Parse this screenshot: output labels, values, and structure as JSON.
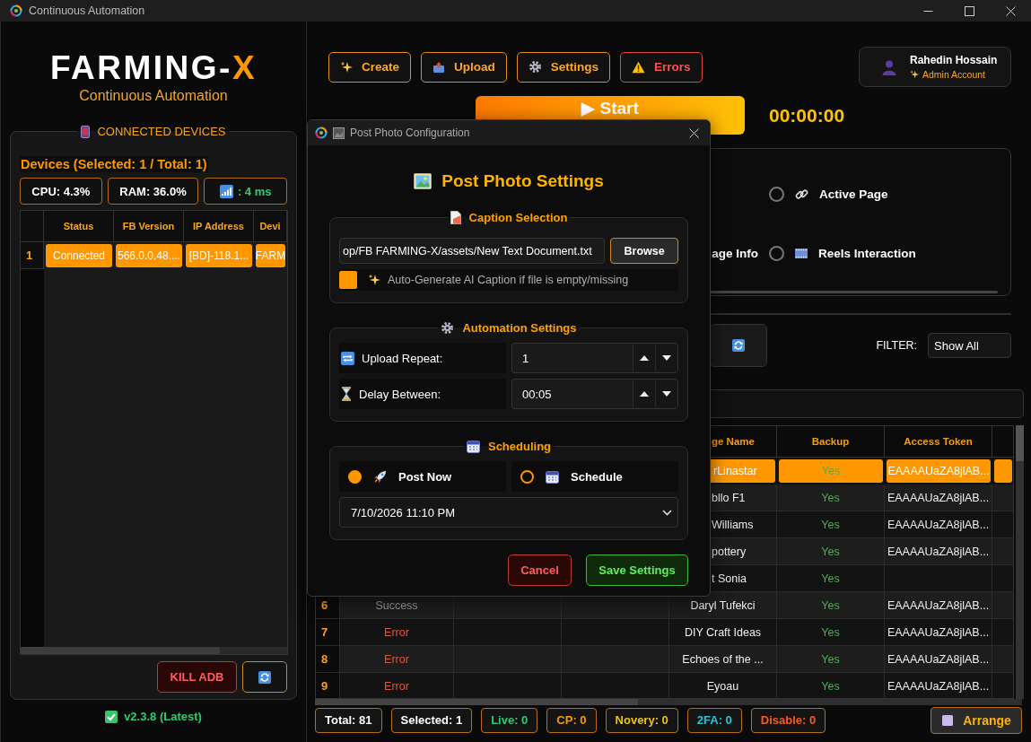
{
  "window": {
    "title": "Continuous Automation"
  },
  "sidebar": {
    "logo": {
      "text": "FARMING-",
      "accent": "X"
    },
    "subtitle": "Continuous Automation",
    "devices": {
      "title": "CONNECTED DEVICES",
      "summary": "Devices (Selected: 1 / Total: 1)",
      "stats": [
        {
          "kind": "cpu",
          "text": "CPU: 4.3%"
        },
        {
          "kind": "ram",
          "text": "RAM: 36.0%"
        },
        {
          "kind": "ping",
          "text": ": 4 ms"
        }
      ],
      "columns": [
        "Status",
        "FB Version",
        "IP Address",
        "Devi"
      ],
      "rows": [
        {
          "index": "1",
          "selected": true,
          "cells": [
            "Connected",
            "566.0.0.48....",
            "[BD]-118.1...",
            "FARM"
          ]
        }
      ],
      "buttons": [
        {
          "kind": "danger",
          "label": "KILL ADB"
        },
        {
          "kind": "refresh"
        }
      ]
    },
    "version": "v2.3.8 (Latest)"
  },
  "toolbar": [
    {
      "kind": "create",
      "label": "Create"
    },
    {
      "kind": "upload",
      "label": "Upload"
    },
    {
      "kind": "settings",
      "label": "Settings"
    },
    {
      "kind": "errors",
      "label": "Errors"
    }
  ],
  "user": {
    "name": "Rahedin Hossain",
    "role": "Admin Account"
  },
  "start": {
    "label": "▶ Start",
    "timer": "00:00:00"
  },
  "options": {
    "fragment": "age Info",
    "items": [
      {
        "kind": "link",
        "label": "Active Page",
        "selected": false
      },
      {
        "kind": "film",
        "label": "Reels Interaction",
        "selected": false
      }
    ]
  },
  "filter": {
    "label": "FILTER:",
    "value": "Show All"
  },
  "table": {
    "columns": {
      "page_name": "ge Name",
      "backup": "Backup",
      "access_token": "Access Token"
    },
    "rows": [
      {
        "selected": true,
        "page_name": "rLinastar",
        "backup": "Yes",
        "access_token": "EAAAAUaZA8jlAB..."
      },
      {
        "selected": false,
        "page_name": "bllo F1",
        "backup": "Yes",
        "access_token": "EAAAAUaZA8jlAB..."
      },
      {
        "selected": false,
        "page_name": "Williams",
        "backup": "Yes",
        "access_token": "EAAAAUaZA8jlAB..."
      },
      {
        "selected": false,
        "page_name": "pottery",
        "backup": "Yes",
        "access_token": "EAAAAUaZA8jlAB..."
      },
      {
        "selected": false,
        "page_name": "t Sonia",
        "backup": "Yes"
      },
      {
        "selected": false,
        "index": "6",
        "status": "Success",
        "kind": "success",
        "page_name": "Daryl Tufekci",
        "backup": "Yes",
        "access_token": "EAAAAUaZA8jlAB..."
      },
      {
        "selected": false,
        "index": "7",
        "status": "Error",
        "kind": "error",
        "page_name": "DIY Craft Ideas",
        "backup": "Yes",
        "access_token": "EAAAAUaZA8jlAB..."
      },
      {
        "selected": false,
        "index": "8",
        "status": "Error",
        "kind": "error",
        "page_name": "Echoes of the ...",
        "backup": "Yes",
        "access_token": "EAAAAUaZA8jlAB..."
      },
      {
        "selected": false,
        "index": "9",
        "status": "Error",
        "kind": "error",
        "page_name": "Eyoau",
        "backup": "Yes",
        "access_token": "EAAAAUaZA8jlAB..."
      }
    ]
  },
  "stats": [
    {
      "kind": "total",
      "text": "Total: 81"
    },
    {
      "kind": "selected",
      "text": "Selected: 1"
    },
    {
      "kind": "live",
      "text": "Live: 0"
    },
    {
      "kind": "cp",
      "text": "CP: 0"
    },
    {
      "kind": "novery",
      "text": "Novery: 0"
    },
    {
      "kind": "twofa",
      "text": "2FA: 0"
    },
    {
      "kind": "disable",
      "text": "Disable: 0"
    }
  ],
  "arrange": {
    "label": "Arrange"
  },
  "dialog": {
    "title": "Post Photo Configuration",
    "heading": "Post Photo Settings",
    "caption": {
      "title": "Caption Selection",
      "path": "op/FB FARMING-X/assets/New Text Document.txt",
      "browse": "Browse",
      "auto_caption": {
        "label": "Auto-Generate AI Caption if file is empty/missing",
        "checked": true
      }
    },
    "automation": {
      "title": "Automation Settings",
      "fields": [
        {
          "kind": "repeat",
          "label": "Upload Repeat:",
          "value": "1"
        },
        {
          "kind": "delay",
          "label": "Delay Between:",
          "value": "00:05"
        }
      ]
    },
    "scheduling": {
      "title": "Scheduling",
      "modes": [
        {
          "kind": "now",
          "label": "Post Now",
          "selected": true
        },
        {
          "kind": "schedule",
          "label": "Schedule",
          "selected": false
        }
      ],
      "datetime": "7/10/2026 11:10 PM"
    },
    "buttons": [
      {
        "kind": "cancel",
        "label": "Cancel"
      },
      {
        "kind": "save",
        "label": "Save Settings"
      }
    ]
  }
}
